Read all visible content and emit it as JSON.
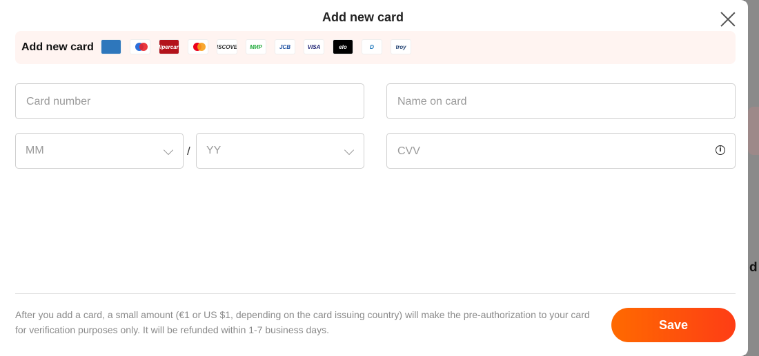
{
  "modal": {
    "title": "Add new card",
    "brand_label": "Add new card",
    "brands": [
      {
        "name": "amex-logo",
        "text": "",
        "bg": "#2e77bc",
        "color": "#ffffff"
      },
      {
        "name": "maestro-logo",
        "text": "",
        "bg": "#ffffff",
        "color": "#000000"
      },
      {
        "name": "hipercard-logo",
        "text": "Hipercard",
        "bg": "#b3131b",
        "color": "#ffffff"
      },
      {
        "name": "mastercard-logo",
        "text": "",
        "bg": "#ffffff",
        "color": "#000000"
      },
      {
        "name": "discover-logo",
        "text": "DISCOVER",
        "bg": "#ffffff",
        "color": "#333333"
      },
      {
        "name": "mir-logo",
        "text": "МИР",
        "bg": "#ffffff",
        "color": "#1faa3a"
      },
      {
        "name": "jcb-logo",
        "text": "JCB",
        "bg": "#ffffff",
        "color": "#1b4fa0"
      },
      {
        "name": "visa-logo",
        "text": "VISA",
        "bg": "#ffffff",
        "color": "#1a1f71"
      },
      {
        "name": "elo-logo",
        "text": "elo",
        "bg": "#000000",
        "color": "#ffffff"
      },
      {
        "name": "diners-logo",
        "text": "D",
        "bg": "#ffffff",
        "color": "#0a6bb5"
      },
      {
        "name": "troy-logo",
        "text": "troy",
        "bg": "#ffffff",
        "color": "#1c3d6e"
      }
    ],
    "card_number_placeholder": "Card number",
    "name_on_card_placeholder": "Name on card",
    "month_placeholder": "MM",
    "year_placeholder": "YY",
    "date_separator": "/",
    "cvv_placeholder": "CVV",
    "notice": "After you add a card, a small amount (€1 or US $1, depending on the card issuing country) will make the pre-authorization to your card for verification purposes only. It will be refunded within 1-7 business days.",
    "save_label": "Save"
  },
  "backdrop": {
    "letter": "d"
  },
  "colors": {
    "accent_start": "#ff6a00",
    "accent_end": "#fe3d15",
    "brand_bar_bg": "#fff4f1"
  }
}
